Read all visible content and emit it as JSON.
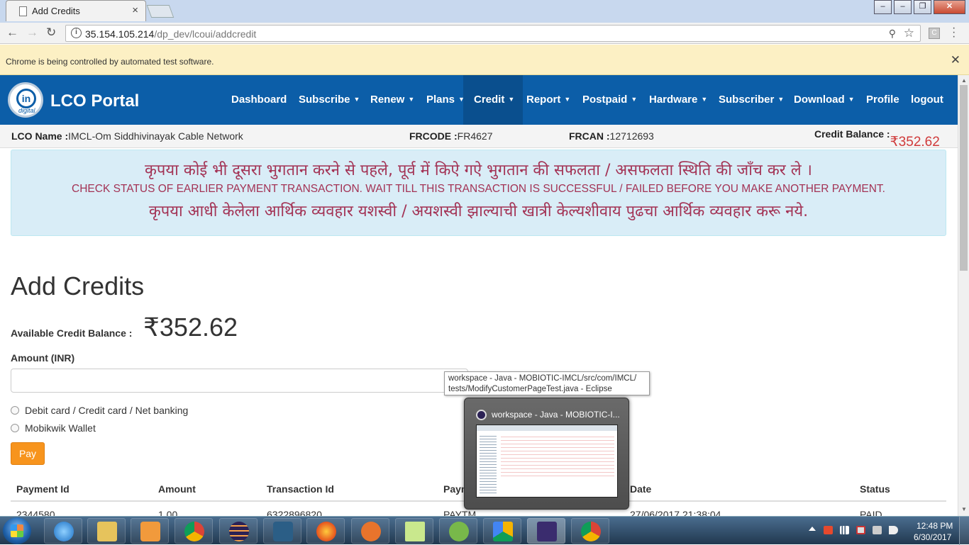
{
  "browser": {
    "tab_title": "Add Credits",
    "tab_close": "×",
    "window_controls": {
      "minimize": "–",
      "restore": "❐",
      "close": "✕"
    },
    "nav": {
      "back": "←",
      "forward": "→",
      "reload": "↻"
    },
    "url_host": "35.154.105.214",
    "url_path": "/dp_dev/lcoui/addcredit",
    "ext_label": "C",
    "infobar_message": "Chrome is being controlled by automated test software.",
    "infobar_close": "✕"
  },
  "navbar": {
    "brand": "LCO Portal",
    "logo_text": "in",
    "logo_sub": "digital",
    "items": [
      {
        "label": "Dashboard",
        "dropdown": false
      },
      {
        "label": "Subscribe",
        "dropdown": true
      },
      {
        "label": "Renew",
        "dropdown": true
      },
      {
        "label": "Plans",
        "dropdown": true
      },
      {
        "label": "Credit",
        "dropdown": true,
        "active": true
      },
      {
        "label": "Report",
        "dropdown": true
      },
      {
        "label": "Postpaid",
        "dropdown": true
      },
      {
        "label": "Hardware",
        "dropdown": true
      },
      {
        "label": "Subscriber",
        "dropdown": true
      },
      {
        "label": "Download",
        "dropdown": true
      },
      {
        "label": "Profile",
        "dropdown": false
      },
      {
        "label": "logout",
        "dropdown": false
      }
    ]
  },
  "lco_info": {
    "name_label": "LCO Name :",
    "name_value": "IMCL-Om Siddhivinayak Cable Network",
    "frcode_label": "FRCODE :",
    "frcode_value": "FR4627",
    "frcan_label": "FRCAN :",
    "frcan_value": "12712693",
    "credit_label": "Credit Balance : ",
    "credit_value": "₹352.62"
  },
  "alert": {
    "hindi": "कृपया कोई भी दूसरा भुगतान करने से पहले, पूर्व में किऐ गऐ भुगतान की सफलता / असफलता स्थिति की जाँच कर ले ।",
    "english": "CHECK STATUS OF EARLIER PAYMENT TRANSACTION. WAIT TILL THIS TRANSACTION IS SUCCESSFUL / FAILED BEFORE YOU MAKE ANOTHER PAYMENT.",
    "marathi": "कृपया आधी केलेला आर्थिक व्यवहार यशस्वी / अयशस्वी झाल्याची खात्री केल्यशीवाय पुढचा आर्थिक व्यवहार करू नये."
  },
  "form": {
    "title": "Add Credits",
    "available_label": "Available Credit Balance :",
    "available_value": "₹352.62",
    "amount_label": "Amount (INR)",
    "amount_value": "",
    "options": [
      "Debit card / Credit card / Net banking",
      "Mobikwik Wallet"
    ],
    "pay_label": "Pay"
  },
  "table": {
    "columns": [
      "Payment Id",
      "Amount",
      "Transaction Id",
      "Payment",
      "Date",
      "Status"
    ],
    "rows": [
      [
        "2344580",
        "1.00",
        "6322896820",
        "PAYTM",
        "27/06/2017 21:38:04",
        "PAID"
      ]
    ]
  },
  "tooltip": {
    "line1": "workspace - Java - MOBIOTIC-IMCL/src/com/IMCL/",
    "line2": "tests/ModifyCustomerPageTest.java - Eclipse"
  },
  "preview": {
    "title": "workspace - Java - MOBIOTIC-I..."
  },
  "taskbar": {
    "apps": [
      "internet-explorer",
      "file-explorer",
      "media-player",
      "chrome",
      "eclipse",
      "mysql-workbench",
      "firefox",
      "tool",
      "sticky-notes",
      "utorrent",
      "google-drive",
      "java-ee-ide",
      "chrome"
    ],
    "time": "12:48 PM",
    "date": "6/30/2017"
  },
  "colors": {
    "navbar": "#0c5ea8",
    "navbar_active": "#0a4f8e",
    "credit_value": "#d03a3a",
    "alert_bg": "#d9edf7",
    "alert_text": "#a33355",
    "pay_button": "#f7941d"
  }
}
